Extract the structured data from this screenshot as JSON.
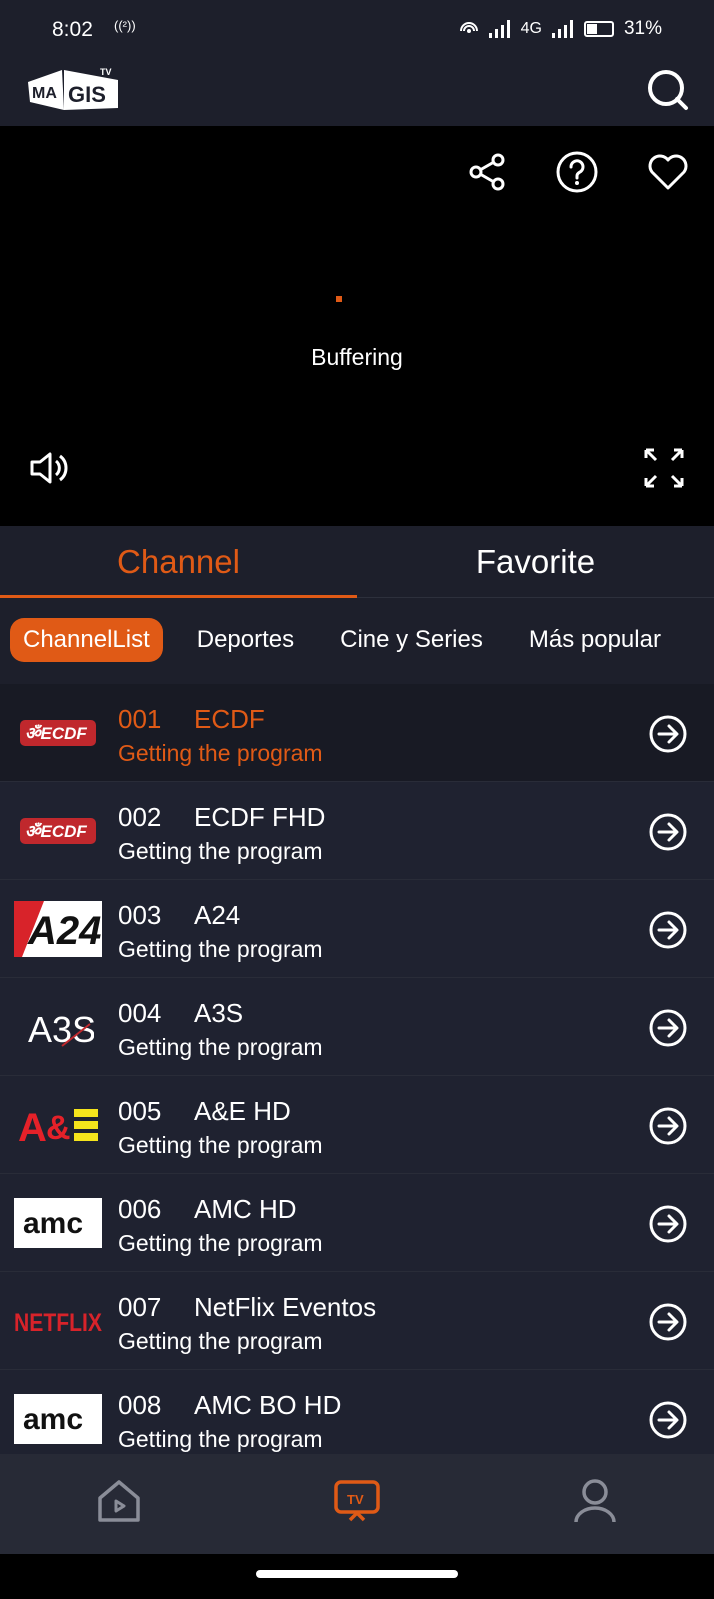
{
  "status": {
    "time": "8:02",
    "cast": "((²))",
    "network": "4G",
    "battery": "31%"
  },
  "app": {
    "logo_text": "MAGIS TV"
  },
  "player": {
    "buffer_text": "Buffering"
  },
  "tabs": [
    {
      "label": "Channel",
      "active": true
    },
    {
      "label": "Favorite",
      "active": false
    }
  ],
  "categories": [
    {
      "label": "ChannelList",
      "active": true
    },
    {
      "label": "Deportes",
      "active": false
    },
    {
      "label": "Cine y Series",
      "active": false
    },
    {
      "label": "Más popular",
      "active": false
    }
  ],
  "channels": [
    {
      "num": "001",
      "name": "ECDF",
      "program": "Getting the program",
      "logo": "ECDF",
      "active": true
    },
    {
      "num": "002",
      "name": "ECDF FHD",
      "program": "Getting the program",
      "logo": "ECDF",
      "active": false
    },
    {
      "num": "003",
      "name": "A24",
      "program": "Getting the program",
      "logo": "A24",
      "active": false
    },
    {
      "num": "004",
      "name": "A3S",
      "program": "Getting the program",
      "logo": "A3S",
      "active": false
    },
    {
      "num": "005",
      "name": "A&E HD",
      "program": "Getting the program",
      "logo": "A&E",
      "active": false
    },
    {
      "num": "006",
      "name": "AMC HD",
      "program": "Getting the program",
      "logo": "amc",
      "active": false
    },
    {
      "num": "007",
      "name": "NetFlix Eventos",
      "program": "Getting the program",
      "logo": "NETFLIX",
      "active": false
    },
    {
      "num": "008",
      "name": "AMC BO HD",
      "program": "Getting the program",
      "logo": "amc",
      "active": false
    }
  ],
  "colors": {
    "accent": "#e05a16",
    "background": "#1d1f2b",
    "nav": "#272a36"
  }
}
